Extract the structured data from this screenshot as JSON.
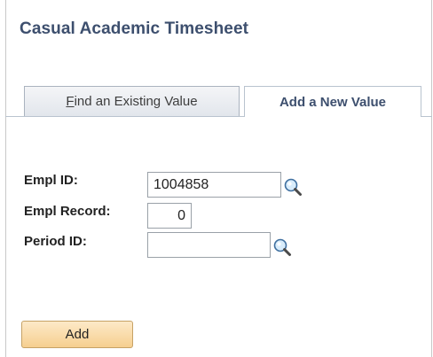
{
  "page": {
    "title": "Casual Academic Timesheet"
  },
  "tabs": [
    {
      "label_prefix": "",
      "label_underlined": "F",
      "label_rest": "ind an Existing Value",
      "selected": false
    },
    {
      "label": "Add a New Value",
      "selected": true
    }
  ],
  "form": {
    "empl_id": {
      "label": "Empl ID:",
      "value": "1004858",
      "icon": "magnifier-lookup-icon"
    },
    "empl_record": {
      "label": "Empl Record:",
      "value": "0"
    },
    "period_id": {
      "label": "Period ID:",
      "value": "",
      "icon": "magnifier-lookup-icon"
    }
  },
  "actions": {
    "add_label": "Add"
  },
  "colors": {
    "title": "#3d4f6e",
    "button_top": "#fde9c8",
    "button_bottom": "#f6cf8f"
  }
}
